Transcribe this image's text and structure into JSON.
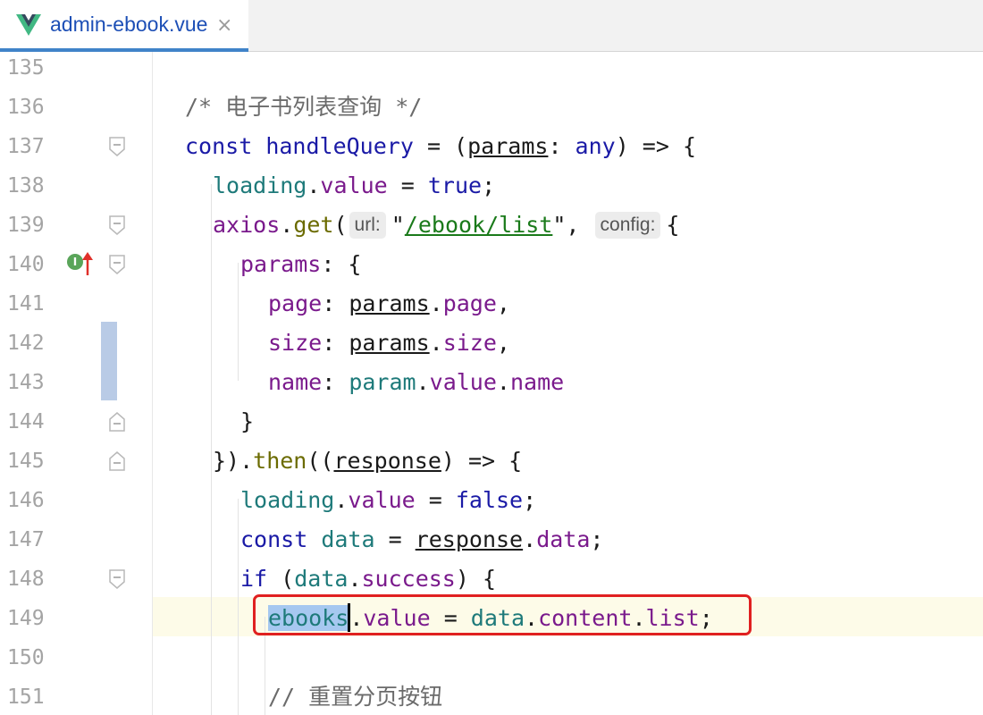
{
  "tab": {
    "icon": "vue-icon",
    "label": "admin-ebook.vue",
    "close": "×"
  },
  "gutter": {
    "implements_marker": "I"
  },
  "lines": [
    {
      "num": "135"
    },
    {
      "num": "136",
      "tokens": [
        "/* 电子书列表查询 */"
      ]
    },
    {
      "num": "137",
      "tokens": [
        "const",
        "handleQuery",
        " = (",
        "params",
        ": ",
        "any",
        ") => {"
      ]
    },
    {
      "num": "138",
      "tokens": [
        "loading",
        ".",
        "value",
        " = ",
        "true",
        ";"
      ]
    },
    {
      "num": "139",
      "tokens": [
        "axios",
        ".",
        "get",
        "(",
        "url:",
        "\"",
        "/ebook/list",
        "\",",
        "config:",
        "{"
      ]
    },
    {
      "num": "140",
      "tokens": [
        "params",
        ": {"
      ]
    },
    {
      "num": "141",
      "tokens": [
        "page",
        ": ",
        "params",
        ".",
        "page",
        ","
      ]
    },
    {
      "num": "142",
      "tokens": [
        "size",
        ": ",
        "params",
        ".",
        "size",
        ","
      ]
    },
    {
      "num": "143",
      "tokens": [
        "name",
        ": ",
        "param",
        ".",
        "value",
        ".",
        "name"
      ]
    },
    {
      "num": "144",
      "tokens": [
        "}"
      ]
    },
    {
      "num": "145",
      "tokens": [
        "}).",
        "then",
        "((",
        "response",
        ") => {"
      ]
    },
    {
      "num": "146",
      "tokens": [
        "loading",
        ".",
        "value",
        " = ",
        "false",
        ";"
      ]
    },
    {
      "num": "147",
      "tokens": [
        "const",
        " ",
        "data",
        " = ",
        "response",
        ".",
        "data",
        ";"
      ]
    },
    {
      "num": "148",
      "tokens": [
        "if",
        " (",
        "data",
        ".",
        "success",
        ") {"
      ]
    },
    {
      "num": "149",
      "tokens": [
        "ebooks",
        ".",
        "value",
        " = ",
        "data",
        ".",
        "content",
        ".",
        "list",
        ";"
      ]
    },
    {
      "num": "150"
    },
    {
      "num": "151",
      "tokens": [
        "// 重置分页按钮"
      ]
    }
  ]
}
